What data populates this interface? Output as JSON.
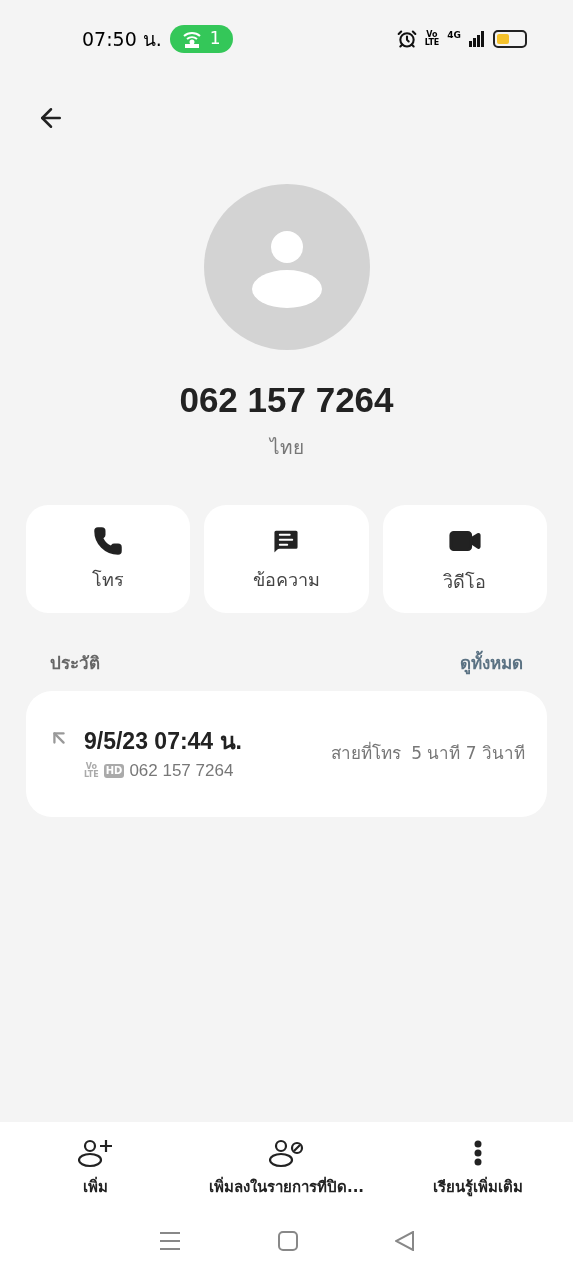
{
  "status_bar": {
    "time": "07:50 น.",
    "hotspot_count": "1",
    "volte_top": "Vo",
    "volte_bottom": "LTE",
    "network": "4G"
  },
  "contact": {
    "number": "062 157 7264",
    "location": "ไทย"
  },
  "actions": [
    {
      "kind": "call",
      "label": "โทร"
    },
    {
      "kind": "message",
      "label": "ข้อความ"
    },
    {
      "kind": "video",
      "label": "วิดีโอ"
    }
  ],
  "history": {
    "title": "ประวัติ",
    "view_all": "ดูทั้งหมด",
    "entries": [
      {
        "kind": "outgoing",
        "datetime": "9/5/23 07:44 น.",
        "volte_top": "Vo",
        "volte_bottom": "LTE",
        "hd": "HD",
        "number": "062 157 7264",
        "type": "สายที่โทร",
        "duration": "5 นาที 7 วินาที"
      }
    ]
  },
  "bottom_actions": [
    {
      "kind": "add",
      "label": "เพิ่ม"
    },
    {
      "kind": "block",
      "label": "เพิ่มลงในรายการที่ปิด..."
    },
    {
      "kind": "more",
      "label": "เรียนรู้เพิ่มเติม"
    }
  ]
}
